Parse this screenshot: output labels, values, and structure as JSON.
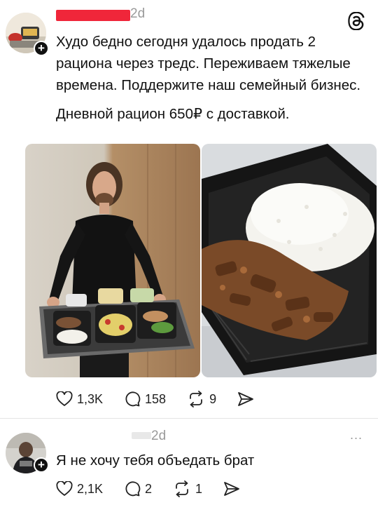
{
  "post": {
    "time": "2d",
    "text_lines": [
      "Худо бедно сегодня удалось продать 2 рациона через тредс. Переживаем тяжелые времена. Поддержите наш семейный бизнес.",
      "Дневной рацион 650₽ с доставкой."
    ],
    "likes": "1,3K",
    "comments": "158",
    "reposts": "9"
  },
  "reply": {
    "time": "2d",
    "text": "Я не хочу тебя объедать брат",
    "likes": "2,1K",
    "comments": "2",
    "reposts": "1",
    "more": "..."
  },
  "colors": {
    "redaction": "#f0263a",
    "muted": "#9a9a9a"
  },
  "icons": [
    "threads-logo-icon",
    "heart-icon",
    "comment-icon",
    "repost-icon",
    "share-icon",
    "plus-icon"
  ]
}
